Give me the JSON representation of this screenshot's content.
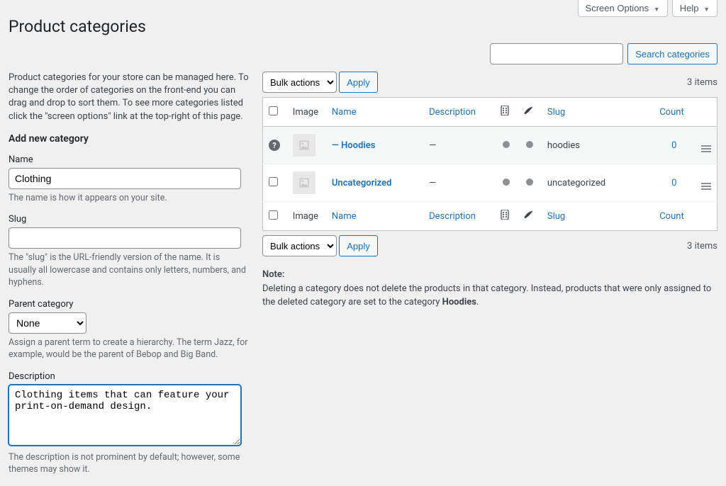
{
  "top": {
    "screen_options": "Screen Options",
    "help": "Help"
  },
  "page_title": "Product categories",
  "search": {
    "button": "Search categories",
    "value": ""
  },
  "intro": "Product categories for your store can be managed here. To change the order of categories on the front-end you can drag and drop to sort them. To see more categories listed click the \"screen options\" link at the top-right of this page.",
  "form": {
    "heading": "Add new category",
    "name_label": "Name",
    "name_value": "Clothing",
    "name_help": "The name is how it appears on your site.",
    "slug_label": "Slug",
    "slug_value": "",
    "slug_help": "The \"slug\" is the URL-friendly version of the name. It is usually all lowercase and contains only letters, numbers, and hyphens.",
    "parent_label": "Parent category",
    "parent_value": "None",
    "parent_help": "Assign a parent term to create a hierarchy. The term Jazz, for example, would be the parent of Bebop and Big Band.",
    "desc_label": "Description",
    "desc_value": "Clothing items that can feature your print-on-demand design.",
    "desc_help": "The description is not prominent by default; however, some themes may show it."
  },
  "bulk": {
    "label": "Bulk actions",
    "apply": "Apply"
  },
  "item_count": "3 items",
  "columns": {
    "image": "Image",
    "name": "Name",
    "description": "Description",
    "slug": "Slug",
    "count": "Count"
  },
  "rows": [
    {
      "name": "— Hoodies",
      "description": "—",
      "slug": "hoodies",
      "count": "0"
    },
    {
      "name": "Uncategorized",
      "description": "—",
      "slug": "uncategorized",
      "count": "0"
    }
  ],
  "note": {
    "label": "Note:",
    "text": "Deleting a category does not delete the products in that category. Instead, products that were only assigned to the deleted category are set to the category ",
    "bold": "Hoodies",
    "text2": "."
  }
}
